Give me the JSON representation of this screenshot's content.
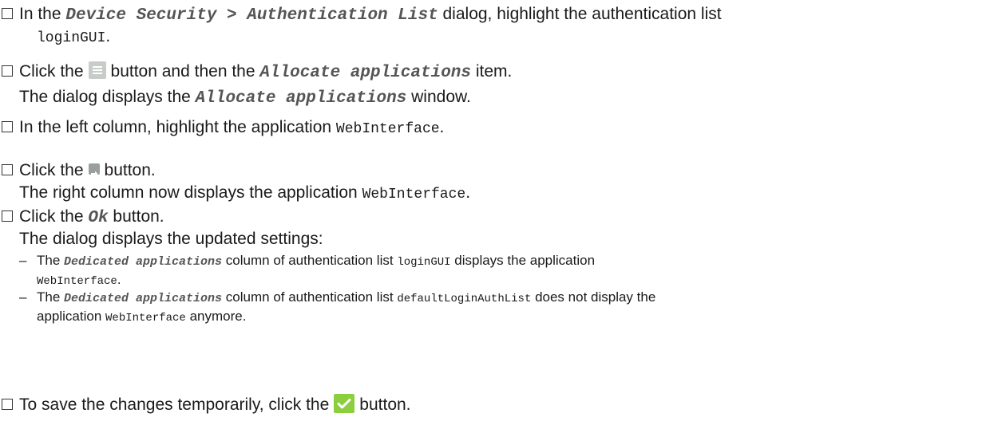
{
  "steps": [
    {
      "l1_a": "In the ",
      "l1_ui": "Device Security > Authentication List",
      "l1_b": " dialog, highlight the authentication list",
      "l2_mono": "loginGUI",
      "l2_b": "."
    },
    {
      "a": "Click the",
      "icon": "menu-icon",
      "b": "button and then the ",
      "ui": "Allocate applications",
      "c": " item.",
      "r_a": "The dialog displays the ",
      "r_ui": "Allocate applications",
      "r_b": " window."
    },
    {
      "a": "In the left column, highlight the application ",
      "mono": "WebInterface",
      "b": "."
    },
    {
      "a": "Click the",
      "icon": "arrow-right-icon",
      "b": "button.",
      "r_a": "The right column now displays the application ",
      "r_mono": "WebInterface",
      "r_b": "."
    },
    {
      "a": "Click the ",
      "ui": "Ok",
      "b": " button.",
      "r": "The dialog displays the updated settings:",
      "bullets": [
        {
          "dash": "–",
          "a": "The ",
          "ui": "Dedicated applications",
          "b": " column of authentication list ",
          "mono": "loginGUI",
          "c": " displays the application",
          "d_mono": "WebInterface",
          "d": "."
        },
        {
          "dash": "–",
          "a": "The ",
          "ui": "Dedicated applications",
          "b": " column of authentication list ",
          "mono": "defaultLoginAuthList",
          "c": " does not display the",
          "d_a": "application ",
          "d_mono": "WebInterface",
          "d_b": " anymore."
        }
      ]
    },
    {
      "a": "To save the changes temporarily, click the",
      "icon": "checkmark-icon",
      "b": "button."
    }
  ],
  "colors": {
    "menu_icon": "#c8ccc9",
    "arrow_icon": "#9a9e9c",
    "check_icon": "#8ccf3e",
    "ui_text": "#555555"
  }
}
